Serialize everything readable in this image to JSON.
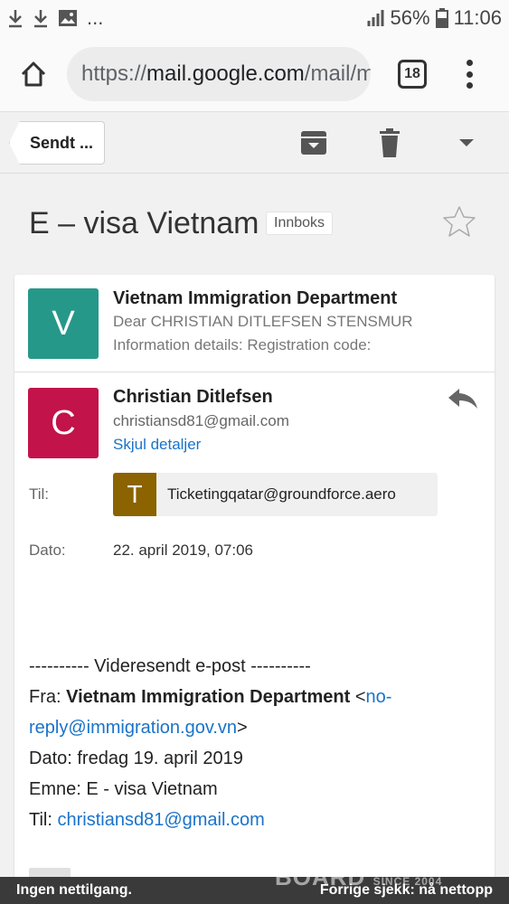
{
  "status_bar": {
    "battery": "56%",
    "time": "11:06",
    "more": "..."
  },
  "browser": {
    "url_scheme": "https://",
    "url_domain": "mail.google.com",
    "url_rest": "/mail/mu/mp",
    "tab_count": "18"
  },
  "toolbar": {
    "back_label": "Sendt ..."
  },
  "thread": {
    "subject": "E – visa Vietnam",
    "label": "Innboks"
  },
  "messages": [
    {
      "avatar_letter": "V",
      "avatar_color": "#26988a",
      "sender": "Vietnam Immigration Department",
      "snippet_line1": "Dear CHRISTIAN DITLEFSEN STENSMUR",
      "snippet_line2": "Information details: Registration code:"
    },
    {
      "avatar_letter": "C",
      "avatar_color": "#c2134a",
      "sender": "Christian Ditlefsen",
      "email": "christiansd81@gmail.com",
      "hide_details": "Skjul detaljer",
      "to_label": "Til:",
      "to_letter": "T",
      "to_address": "Ticketingqatar@groundforce.aero",
      "date_label": "Dato:",
      "date_value": "22. april 2019, 07:06"
    }
  ],
  "forwarded": {
    "header": "---------- Videresendt e-post ----------",
    "from_label": "Fra:",
    "from_name": "Vietnam Immigration Department",
    "from_lt": "<",
    "from_email_a": "no-",
    "from_email_b": "reply@immigration.gov.vn",
    "from_gt": ">",
    "date_line": "Dato: fredag 19. april 2019",
    "subject_line": "Emne: E - visa Vietnam",
    "to_label": "Til:",
    "to_email": "christiansd81@gmail.com"
  },
  "offline": {
    "left": "Ingen nettilgang.",
    "right": "Forrige sjekk: nå nettopp"
  },
  "watermark": {
    "brand": "BOARD",
    "since": "SINCE 2004"
  }
}
